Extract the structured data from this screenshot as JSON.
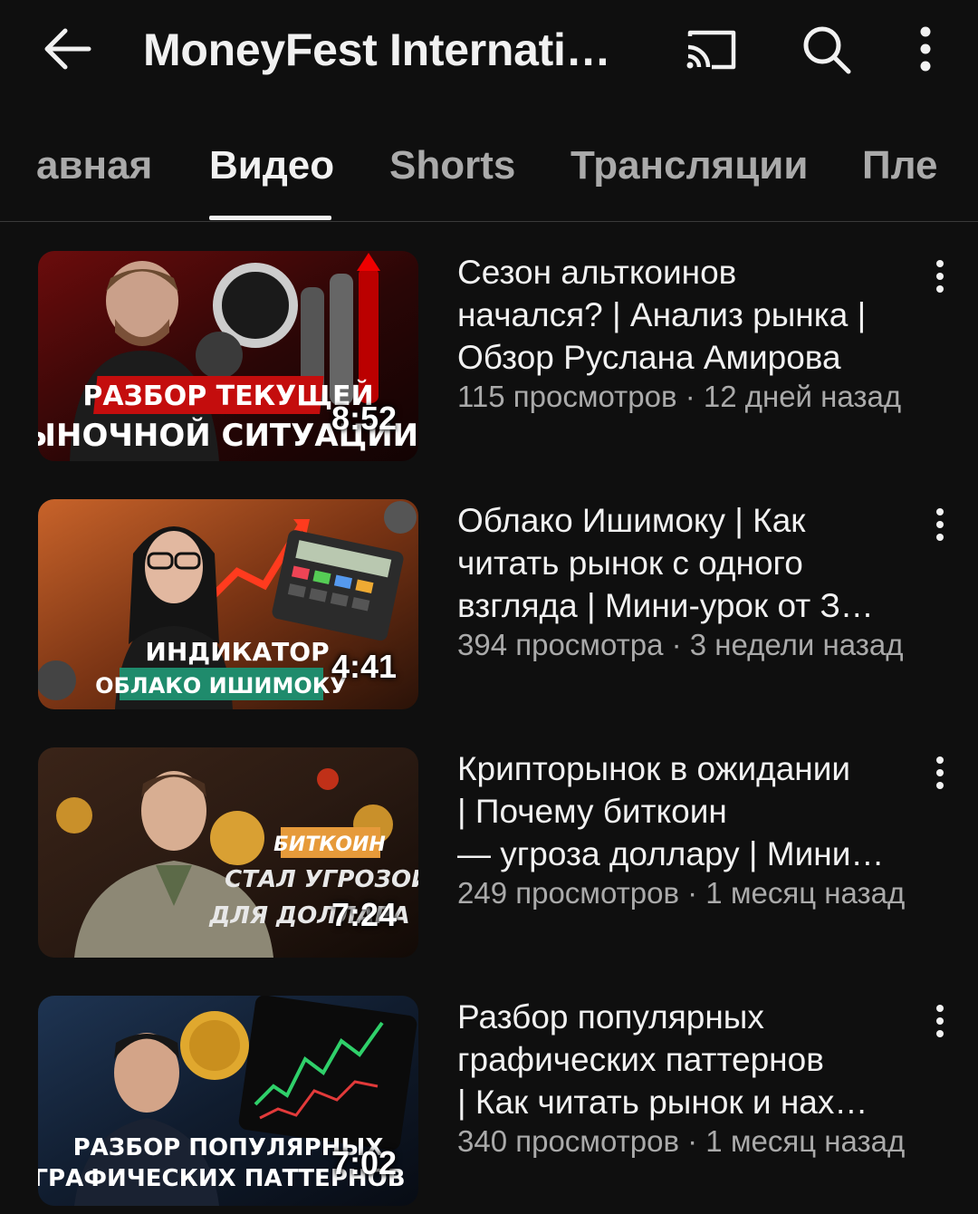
{
  "header": {
    "title": "MoneyFest Internatio…",
    "icons": [
      "back-arrow-icon",
      "cast-icon",
      "search-icon",
      "more-vert-icon"
    ]
  },
  "tabs": [
    {
      "label": "авная",
      "active": false
    },
    {
      "label": "Видео",
      "active": true
    },
    {
      "label": "Shorts",
      "active": false
    },
    {
      "label": "Трансляции",
      "active": false
    },
    {
      "label": "Пле",
      "active": false
    }
  ],
  "videos": [
    {
      "title_lines": [
        "Сезон альткоинов",
        "начался? | Анализ рынка |",
        "Обзор Руслана Амирова"
      ],
      "meta": "115 просмотров · 12 дней назад",
      "duration": "8:52",
      "overlay": [
        "РАЗБОР ТЕКУЩЕЙ",
        "РЫНОЧНОЙ СИТУАЦИИ"
      ]
    },
    {
      "title_lines": [
        "Облако Ишимоку | Как",
        "читать рынок с одного",
        "взгляда | Мини-урок от З…"
      ],
      "meta": "394 просмотра · 3 недели назад",
      "duration": "4:41",
      "overlay": [
        "ИНДИКАТОР",
        "ОБЛАКО ИШИМОКУ"
      ]
    },
    {
      "title_lines": [
        "Крипторынок в ожидании",
        "| Почему биткоин",
        "— угроза доллару | Мини…"
      ],
      "meta": "249 просмотров · 1 месяц назад",
      "duration": "7:24",
      "overlay": [
        "БИТКОИН",
        "СТАЛ УГРОЗОЙ",
        "ДЛЯ ДОЛЛАРА"
      ]
    },
    {
      "title_lines": [
        "Разбор популярных",
        "графических паттернов",
        "| Как читать рынок и нах…"
      ],
      "meta": "340 просмотров · 1 месяц назад",
      "duration": "7:02",
      "overlay": [
        "РАЗБОР ПОПУЛЯРНЫХ",
        "ГРАФИЧЕСКИХ ПАТТЕРНОВ"
      ]
    }
  ],
  "colors": {
    "background": "#0f0f0f",
    "text_primary": "#f1f1f1",
    "text_secondary": "#aaaaaa"
  }
}
